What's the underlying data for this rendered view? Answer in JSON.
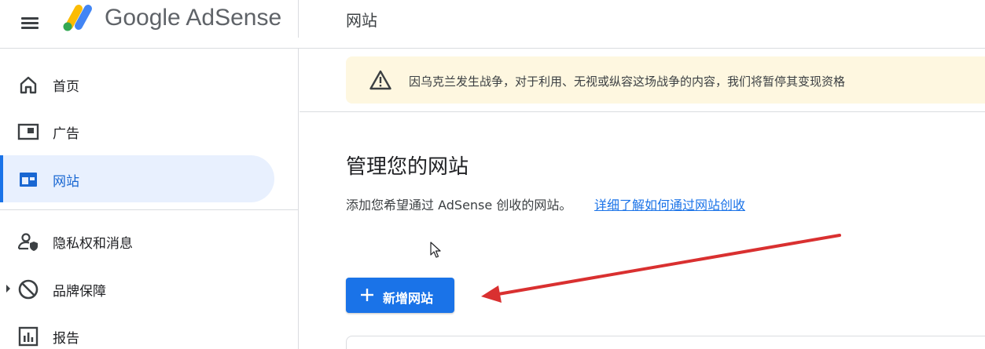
{
  "header": {
    "logo_text": "Google AdSense",
    "page_title": "网站"
  },
  "sidebar": {
    "items": [
      {
        "label": "首页",
        "icon": "home-icon"
      },
      {
        "label": "广告",
        "icon": "ads-icon"
      },
      {
        "label": "网站",
        "icon": "sites-icon",
        "active": true
      },
      {
        "label": "隐私权和消息",
        "icon": "privacy-icon"
      },
      {
        "label": "品牌保障",
        "icon": "block-icon"
      },
      {
        "label": "报告",
        "icon": "reports-icon"
      }
    ]
  },
  "banner": {
    "icon": "warning-icon",
    "text": "因乌克兰发生战争，对于利用、无视或纵容这场战争的内容，我们将暂停其变现资格"
  },
  "main": {
    "title": "管理您的网站",
    "description": "添加您希望通过 AdSense 创收的网站。",
    "learn_link": "详细了解如何通过网站创收",
    "add_button_label": "新增网站"
  },
  "colors": {
    "accent": "#1a73e8",
    "active_bg": "#e8f0fe",
    "banner_bg": "#fef7e0",
    "annotation_arrow": "#d93030"
  }
}
